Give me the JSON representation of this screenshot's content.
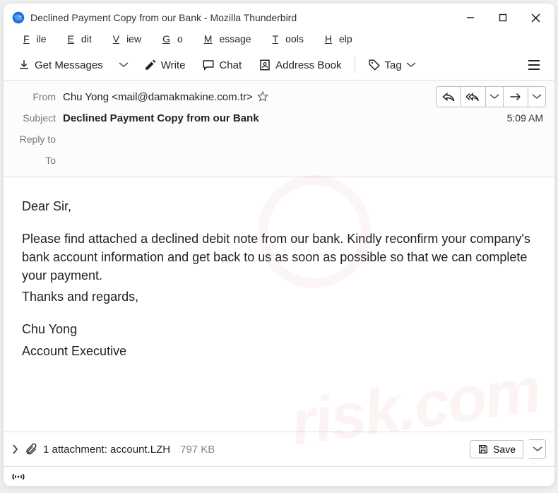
{
  "title": "Declined Payment Copy from our Bank - Mozilla Thunderbird",
  "menus": {
    "file": "File",
    "edit": "Edit",
    "view": "View",
    "go": "Go",
    "message": "Message",
    "tools": "Tools",
    "help": "Help"
  },
  "toolbar": {
    "get": "Get Messages",
    "write": "Write",
    "chat": "Chat",
    "address": "Address Book",
    "tag": "Tag"
  },
  "headers": {
    "from_label": "From",
    "from": "Chu Yong <mail@damakmakine.com.tr>",
    "subject_label": "Subject",
    "subject": "Declined Payment Copy from our Bank",
    "time": "5:09 AM",
    "replyto_label": "Reply to",
    "to_label": "To"
  },
  "body": {
    "greeting": "Dear Sir,",
    "p1": "Please find attached a declined debit note from our bank. Kindly reconfirm your company's bank account information and get back to us as soon as possible so that we can complete your payment.",
    "p2": "Thanks and regards,",
    "sig1": "Chu Yong",
    "sig2": "Account Executive"
  },
  "attachment": {
    "label": "1 attachment: account.LZH",
    "size": "797 KB",
    "save": "Save"
  }
}
